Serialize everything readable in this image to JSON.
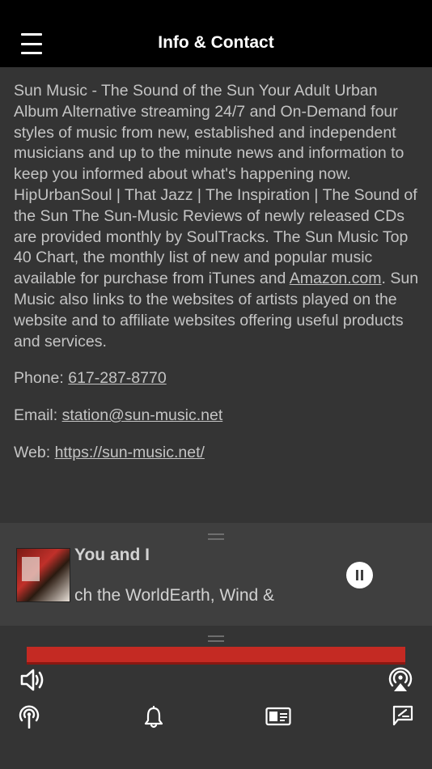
{
  "header": {
    "title": "Info & Contact",
    "menu_icon": "hamburger-menu-icon"
  },
  "about": {
    "before_link": "Sun Music - The Sound of the Sun Your Adult Urban Album Alternative streaming 24/7 and On-Demand four styles of music from new, established and independent musicians and up to the minute news and information to keep you informed about what's happening now. HipUrbanSoul | That Jazz | The Inspiration | The Sound of the Sun The Sun-Music Reviews of newly released CDs are provided monthly by SoulTracks. The Sun Music Top 40 Chart, the monthly list of new and popular music available for purchase from iTunes and ",
    "link_text": "Amazon.com",
    "after_link": ". Sun Music also links to the websites of artists played on the website and to affiliate websites offering useful products and services."
  },
  "contact": {
    "phone_label": "Phone: ",
    "phone": "617-287-8770",
    "email_label": "Email: ",
    "email": "station@sun-music.net",
    "web_label": "Web: ",
    "web": "https://sun-music.net/"
  },
  "player": {
    "title": "You and I",
    "artist": "ch the WorldEarth, Wind &",
    "state": "playing"
  },
  "bottom_bar": {
    "icons": [
      "volume-icon",
      "airplay-icon",
      "podcast-icon",
      "bell-icon",
      "contact-card-icon",
      "feedback-icon"
    ]
  },
  "colors": {
    "background": "#343434",
    "header": "#000000",
    "player": "#3f3f3f",
    "text": "#c4c4c4",
    "banner": "#c42a23"
  }
}
